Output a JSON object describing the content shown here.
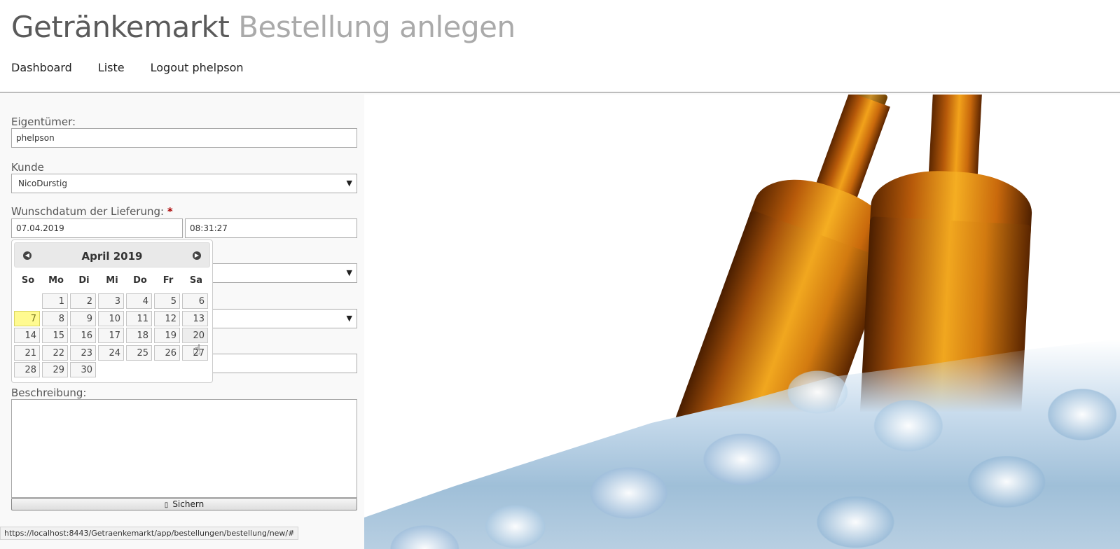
{
  "header": {
    "title": "Getränkemarkt",
    "subtitle": "Bestellung anlegen",
    "nav": [
      {
        "label": "Dashboard"
      },
      {
        "label": "Liste"
      },
      {
        "label": "Logout phelpson"
      }
    ]
  },
  "form": {
    "owner_label": "Eigentümer:",
    "owner_value": "phelpson",
    "customer_label": "Kunde",
    "customer_value": "NicoDurstig",
    "delivery_label": "Wunschdatum der Lieferung:",
    "required_marker": "*",
    "date_value": "07.04.2019",
    "time_value": "08:31:27",
    "description_label": "Beschreibung:",
    "description_value": "",
    "save_label": "Sichern",
    "save_icon": "save-icon"
  },
  "datepicker": {
    "title": "April 2019",
    "prev_icon": "◀",
    "next_icon": "▶",
    "weekdays": [
      "So",
      "Mo",
      "Di",
      "Mi",
      "Do",
      "Fr",
      "Sa"
    ],
    "days": [
      "1",
      "2",
      "3",
      "4",
      "5",
      "6",
      "7",
      "8",
      "9",
      "10",
      "11",
      "12",
      "13",
      "14",
      "15",
      "16",
      "17",
      "18",
      "19",
      "20",
      "21",
      "22",
      "23",
      "24",
      "25",
      "26",
      "27",
      "28",
      "29",
      "30"
    ],
    "first_weekday_index": 1,
    "today": "7",
    "hovered": "20"
  },
  "statusbar": {
    "url": "https://localhost:8443/Getraenkemarkt/app/bestellungen/bestellung/new/#"
  },
  "colors": {
    "today_highlight": "#fffa90",
    "title_main": "#5a5a5a",
    "title_sub": "#aaaaaa",
    "beer": "#f2a21b"
  }
}
